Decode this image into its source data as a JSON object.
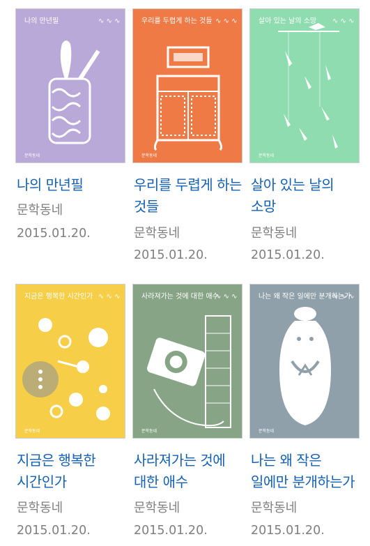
{
  "books": [
    {
      "title": "나의 만년필",
      "cover_title": "나의 만년필",
      "publisher": "문학동네",
      "date": "2015.01.20.",
      "cover_color": "#b8a9d8"
    },
    {
      "title": "우리를 두렵게 하는 것들",
      "cover_title": "우리를 두렵게 하는 것들",
      "publisher": "문학동네",
      "date": "2015.01.20.",
      "cover_color": "#f07a45"
    },
    {
      "title": "살아 있는 날의 소망",
      "cover_title": "살아 있는 날의 소망",
      "publisher": "문학동네",
      "date": "2015.01.20.",
      "cover_color": "#8fdcb0"
    },
    {
      "title": "지금은 행복한 시간인가",
      "cover_title": "지금은 행복한 시간인가",
      "publisher": "문학동네",
      "date": "2015.01.20.",
      "cover_color": "#f6ce48"
    },
    {
      "title": "사라져가는 것에 대한 애수",
      "cover_title": "사라져가는 것에 대한 애수",
      "publisher": "문학동네",
      "date": "2015.01.20.",
      "cover_color": "#87a586"
    },
    {
      "title": "나는 왜 작은 일에만 분개하는가",
      "cover_title": "나는 왜 작은 일에만 분개하는가",
      "publisher": "문학동네",
      "date": "2015.01.20.",
      "cover_color": "#8fa0aa"
    }
  ],
  "icons": {
    "more": "more-vertical-icon"
  }
}
